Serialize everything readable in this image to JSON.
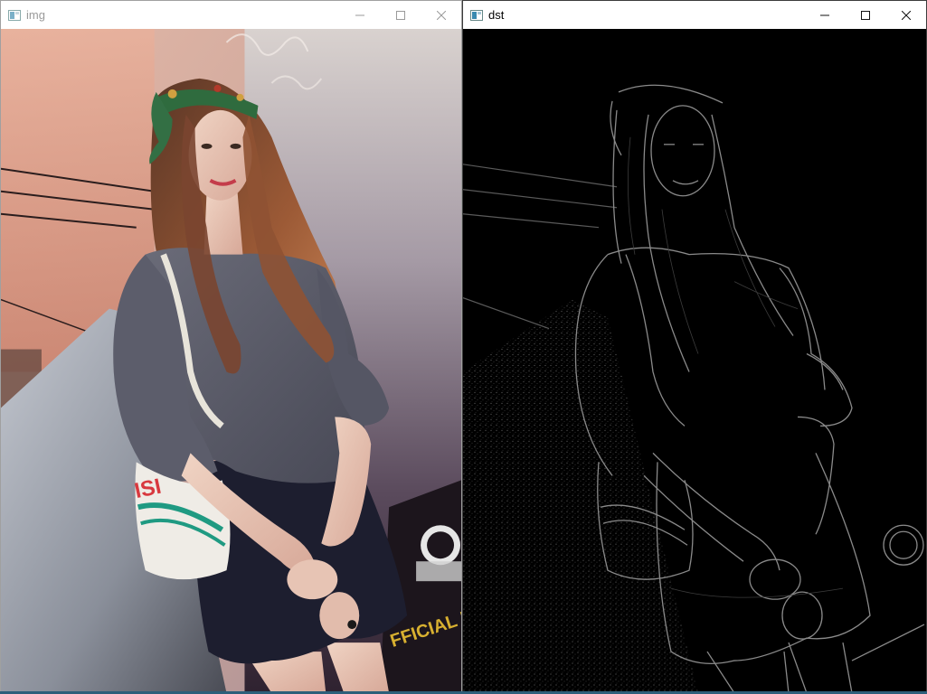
{
  "windows": {
    "img": {
      "title": "img",
      "active": false,
      "canvas_label": "",
      "visible_text": "FFICIAL R",
      "bag_text": "ISI"
    },
    "dst": {
      "title": "dst",
      "active": true,
      "canvas_label": ""
    }
  },
  "colors": {
    "titlebar_bg": "#ffffff",
    "inactive_title": "#9a9a9a",
    "active_title": "#000000",
    "edge_bg": "#000000"
  },
  "icons": {
    "app": "window-app-icon",
    "minimize": "minimize-icon",
    "maximize": "maximize-icon",
    "close": "close-icon"
  }
}
